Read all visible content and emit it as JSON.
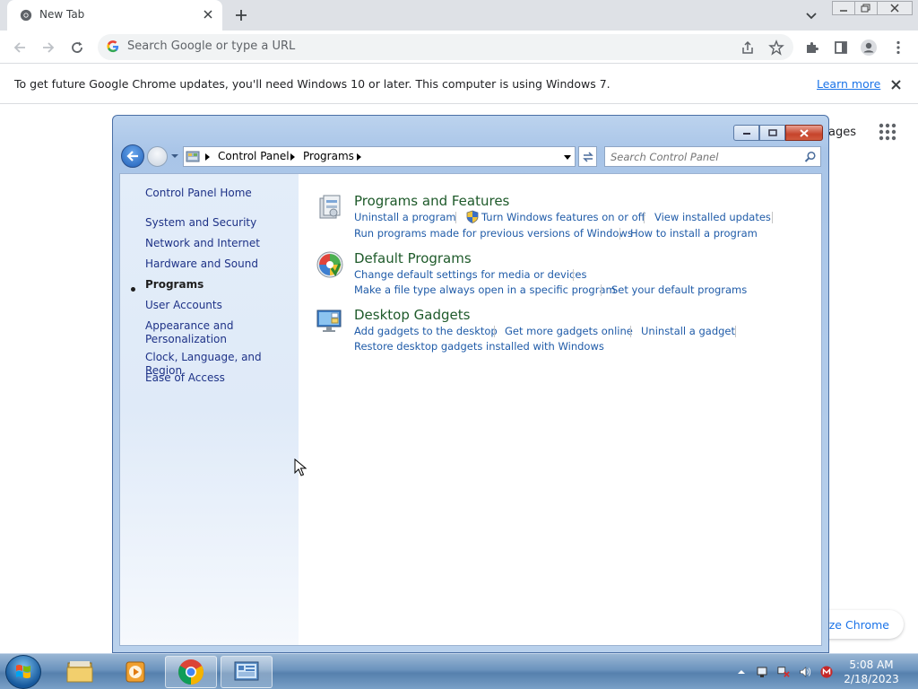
{
  "browser": {
    "tab_title": "New Tab",
    "omnibox_placeholder": "Search Google or type a URL",
    "infobar": {
      "message": "To get future Google Chrome updates, you'll need Windows 10 or later. This computer is using Windows 7.",
      "link": "Learn more"
    },
    "ntp": {
      "pages_fragment": "ages",
      "customize_fragment": "ize Chrome"
    }
  },
  "control_panel": {
    "breadcrumb": [
      "Control Panel",
      "Programs"
    ],
    "search_placeholder": "Search Control Panel",
    "sidebar": {
      "home": "Control Panel Home",
      "items": [
        "System and Security",
        "Network and Internet",
        "Hardware and Sound",
        "Programs",
        "User Accounts",
        "Appearance and",
        "Personalization",
        "Clock, Language, and Region",
        "Ease of Access"
      ],
      "current": "Programs"
    },
    "categories": [
      {
        "title": "Programs and Features",
        "icon": "programs-features-icon",
        "links": [
          "Uninstall a program",
          "Turn Windows features on or off",
          "View installed updates",
          "Run programs made for previous versions of Windows",
          "How to install a program"
        ]
      },
      {
        "title": "Default Programs",
        "icon": "default-programs-icon",
        "links": [
          "Change default settings for media or devices",
          "Make a file type always open in a specific program",
          "Set your default programs"
        ]
      },
      {
        "title": "Desktop Gadgets",
        "icon": "desktop-gadgets-icon",
        "links": [
          "Add gadgets to the desktop",
          "Get more gadgets online",
          "Uninstall a gadget",
          "Restore desktop gadgets installed with Windows"
        ]
      }
    ]
  },
  "taskbar": {
    "time": "5:08 AM",
    "date": "2/18/2023"
  },
  "colors": {
    "chrome_link": "#1a73e8",
    "cp_link": "#1f5ba8",
    "cp_category_title": "#1e5a2a",
    "cp_sidebar_link": "#1e3287"
  }
}
